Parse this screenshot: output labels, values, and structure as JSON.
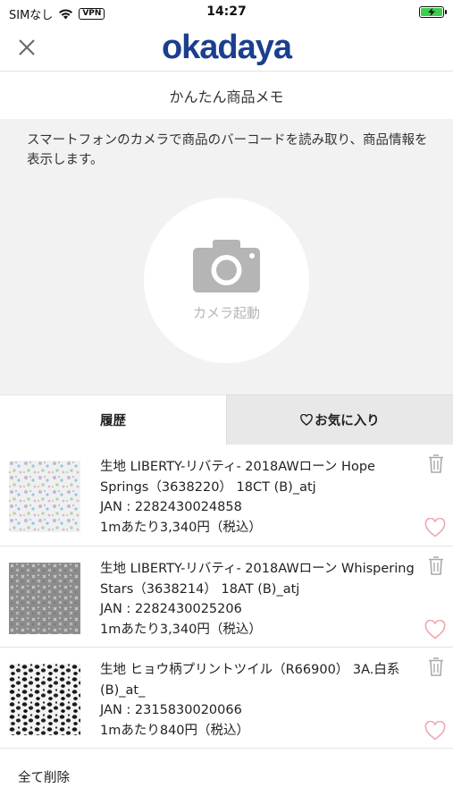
{
  "status_bar": {
    "carrier": "SIMなし",
    "vpn": "VPN",
    "time": "14:27",
    "battery_color": "#3ccf4e"
  },
  "header": {
    "close_icon": "close-icon",
    "logo_text": "okadaya",
    "logo_color": "#1b3f8f"
  },
  "page_title": "かんたん商品メモ",
  "camera": {
    "description": "スマートフォンのカメラで商品のバーコードを読み取り、商品情報を表示します。",
    "button_label": "カメラ起動",
    "icon": "camera-icon"
  },
  "tabs": {
    "history": "履歴",
    "favorites": "お気に入り",
    "active": "history"
  },
  "products": [
    {
      "name": "生地 LIBERTY-リバティ- 2018AWローン Hope Springs（3638220） 18CT (B)_atj",
      "jan": "JAN : 2282430024858",
      "price": "1mあたり3,340円（税込）"
    },
    {
      "name": "生地 LIBERTY-リバティ- 2018AWローン Whispering Stars（3638214） 18AT (B)_atj",
      "jan": "JAN : 2282430025206",
      "price": "1mあたり3,340円（税込）"
    },
    {
      "name": "生地 ヒョウ柄プリントツイル（R66900） 3A.白系 (B)_at_",
      "jan": "JAN : 2315830020066",
      "price": "1mあたり840円（税込）"
    }
  ],
  "delete_all": "全て削除",
  "colors": {
    "heart": "#f0a6b0",
    "camera_bg": "#f2f2f2"
  }
}
